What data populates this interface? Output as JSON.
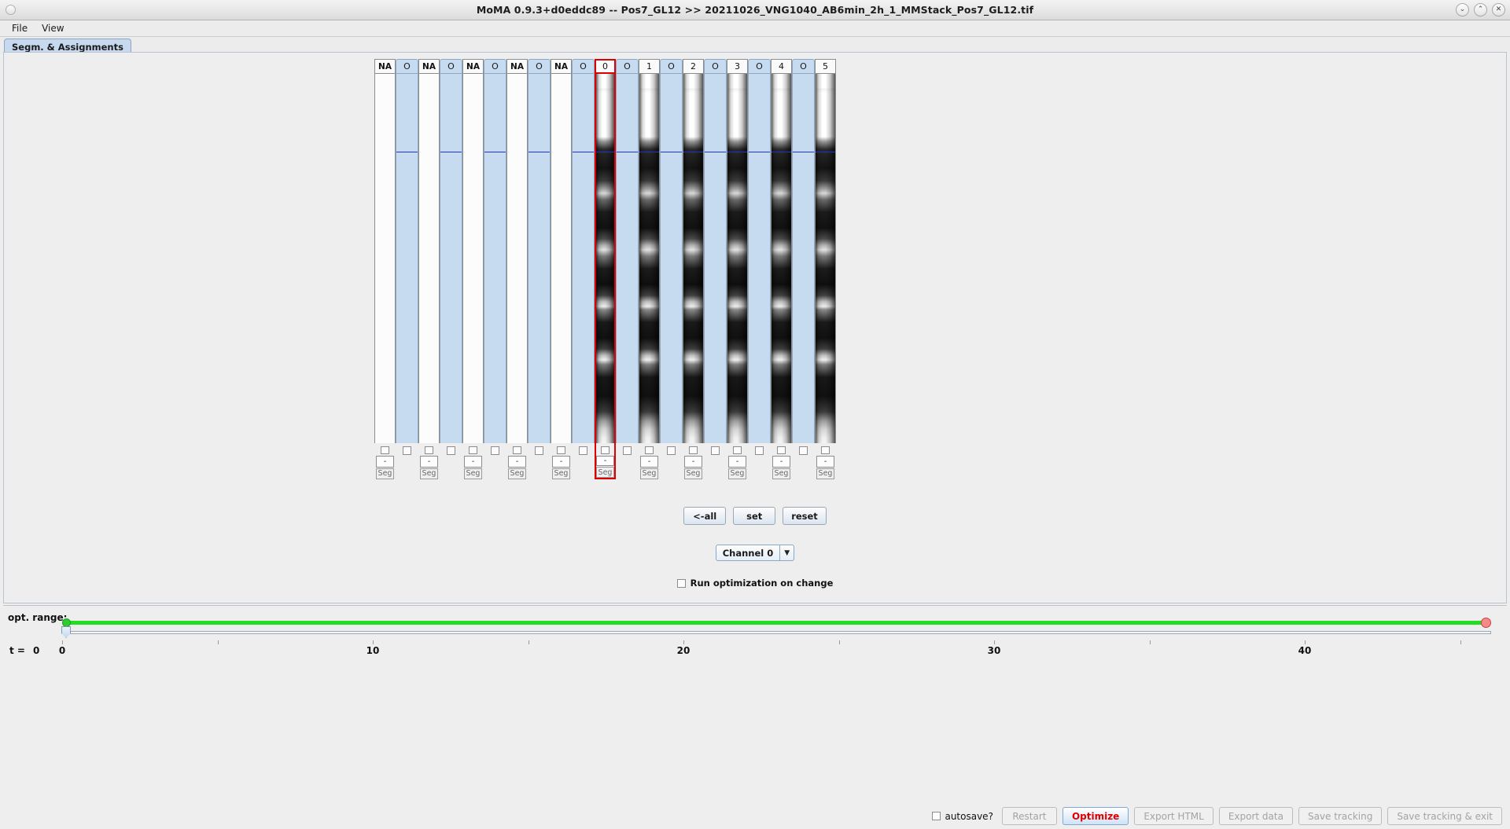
{
  "window": {
    "title": "MoMA 0.9.3+d0eddc89 -- Pos7_GL12 >> 20211026_VNG1040_AB6min_2h_1_MMStack_Pos7_GL12.tif",
    "minimize": "⌄",
    "maximize": "⌃",
    "close": "✕"
  },
  "menu": {
    "items": [
      {
        "label": "File"
      },
      {
        "label": "View"
      }
    ]
  },
  "tabs": [
    {
      "label": "Segm. & Assignments",
      "selected": true
    }
  ],
  "columns": [
    {
      "type": "na",
      "header": "NA",
      "checked": false,
      "dash": "-",
      "seg": "Seg",
      "selected": false
    },
    {
      "type": "assign",
      "header": "O",
      "checked": false,
      "selected": false
    },
    {
      "type": "na",
      "header": "NA",
      "checked": false,
      "dash": "-",
      "seg": "Seg",
      "selected": false
    },
    {
      "type": "assign",
      "header": "O",
      "checked": false,
      "selected": false
    },
    {
      "type": "na",
      "header": "NA",
      "checked": false,
      "dash": "-",
      "seg": "Seg",
      "selected": false
    },
    {
      "type": "assign",
      "header": "O",
      "checked": false,
      "selected": false
    },
    {
      "type": "na",
      "header": "NA",
      "checked": false,
      "dash": "-",
      "seg": "Seg",
      "selected": false
    },
    {
      "type": "assign",
      "header": "O",
      "checked": false,
      "selected": false
    },
    {
      "type": "na",
      "header": "NA",
      "checked": false,
      "dash": "-",
      "seg": "Seg",
      "selected": false
    },
    {
      "type": "assign",
      "header": "O",
      "checked": false,
      "selected": false
    },
    {
      "type": "gl",
      "header": "0",
      "checked": false,
      "dash": "-",
      "seg": "Seg",
      "selected": true
    },
    {
      "type": "assign",
      "header": "O",
      "checked": false,
      "selected": false
    },
    {
      "type": "gl",
      "header": "1",
      "checked": false,
      "dash": "-",
      "seg": "Seg",
      "selected": false
    },
    {
      "type": "assign",
      "header": "O",
      "checked": false,
      "selected": false
    },
    {
      "type": "gl",
      "header": "2",
      "checked": false,
      "dash": "-",
      "seg": "Seg",
      "selected": false
    },
    {
      "type": "assign",
      "header": "O",
      "checked": false,
      "selected": false
    },
    {
      "type": "gl",
      "header": "3",
      "checked": false,
      "dash": "-",
      "seg": "Seg",
      "selected": false
    },
    {
      "type": "assign",
      "header": "O",
      "checked": false,
      "selected": false
    },
    {
      "type": "gl",
      "header": "4",
      "checked": false,
      "dash": "-",
      "seg": "Seg",
      "selected": false
    },
    {
      "type": "assign",
      "header": "O",
      "checked": false,
      "selected": false
    },
    {
      "type": "gl",
      "header": "5",
      "checked": false,
      "dash": "-",
      "seg": "Seg",
      "selected": false
    }
  ],
  "controls": {
    "all_button": "<-all",
    "set_button": "set",
    "reset_button": "reset",
    "channel_value": "Channel 0",
    "channel_arrow": "▼",
    "run_opt_label": "Run optimization on change",
    "run_opt_checked": false
  },
  "slider": {
    "opt_range_label": "opt. range:",
    "t_label": "t =",
    "t_value": "0",
    "axis_ticks": [
      {
        "value": 0,
        "label": "0"
      },
      {
        "value": 10,
        "label": "10"
      },
      {
        "value": 20,
        "label": "20"
      },
      {
        "value": 30,
        "label": "30"
      },
      {
        "value": 40,
        "label": "40"
      }
    ],
    "axis_min": 0,
    "axis_max": 46,
    "range_start": 0,
    "range_end": 46,
    "accent_green": "#22dd22",
    "accent_red": "#f58a8a"
  },
  "actions": {
    "autosave_label": "autosave?",
    "autosave_checked": false,
    "buttons": [
      {
        "label": "Restart",
        "enabled": false,
        "primary": false
      },
      {
        "label": "Optimize",
        "enabled": true,
        "primary": true
      },
      {
        "label": "Export HTML",
        "enabled": false,
        "primary": false
      },
      {
        "label": "Export data",
        "enabled": false,
        "primary": false
      },
      {
        "label": "Save tracking",
        "enabled": false,
        "primary": false
      },
      {
        "label": "Save tracking & exit",
        "enabled": false,
        "primary": false
      }
    ]
  }
}
